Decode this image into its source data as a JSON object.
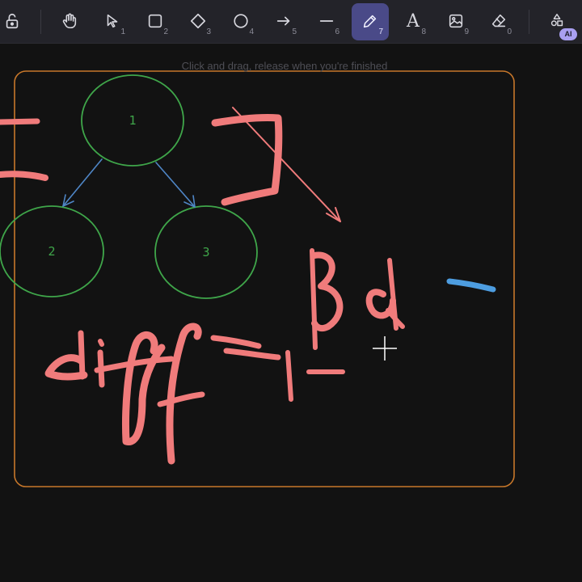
{
  "toolbar": {
    "tools": [
      {
        "name": "lock",
        "key": ""
      },
      {
        "name": "hand",
        "key": ""
      },
      {
        "name": "selection",
        "key": "1"
      },
      {
        "name": "rectangle",
        "key": "2"
      },
      {
        "name": "diamond",
        "key": "3"
      },
      {
        "name": "ellipse",
        "key": "4"
      },
      {
        "name": "arrow",
        "key": "5"
      },
      {
        "name": "line",
        "key": "6"
      },
      {
        "name": "draw",
        "key": "7",
        "active": true
      },
      {
        "name": "text",
        "key": "8",
        "glyph": "A"
      },
      {
        "name": "image",
        "key": "9"
      },
      {
        "name": "eraser",
        "key": "0"
      },
      {
        "name": "more-tools",
        "key": ""
      }
    ],
    "ai_badge": "AI"
  },
  "canvas": {
    "hint": "Click and drag, release when you're finished",
    "nodes": [
      {
        "label": "1"
      },
      {
        "label": "2"
      },
      {
        "label": "3"
      }
    ],
    "colors": {
      "background": "#121212",
      "frame": "#c7772a",
      "node": "#3fa64a",
      "edge": "#4f86c6",
      "ink": "#f07b7b",
      "blue_ink": "#4d9de0"
    }
  }
}
